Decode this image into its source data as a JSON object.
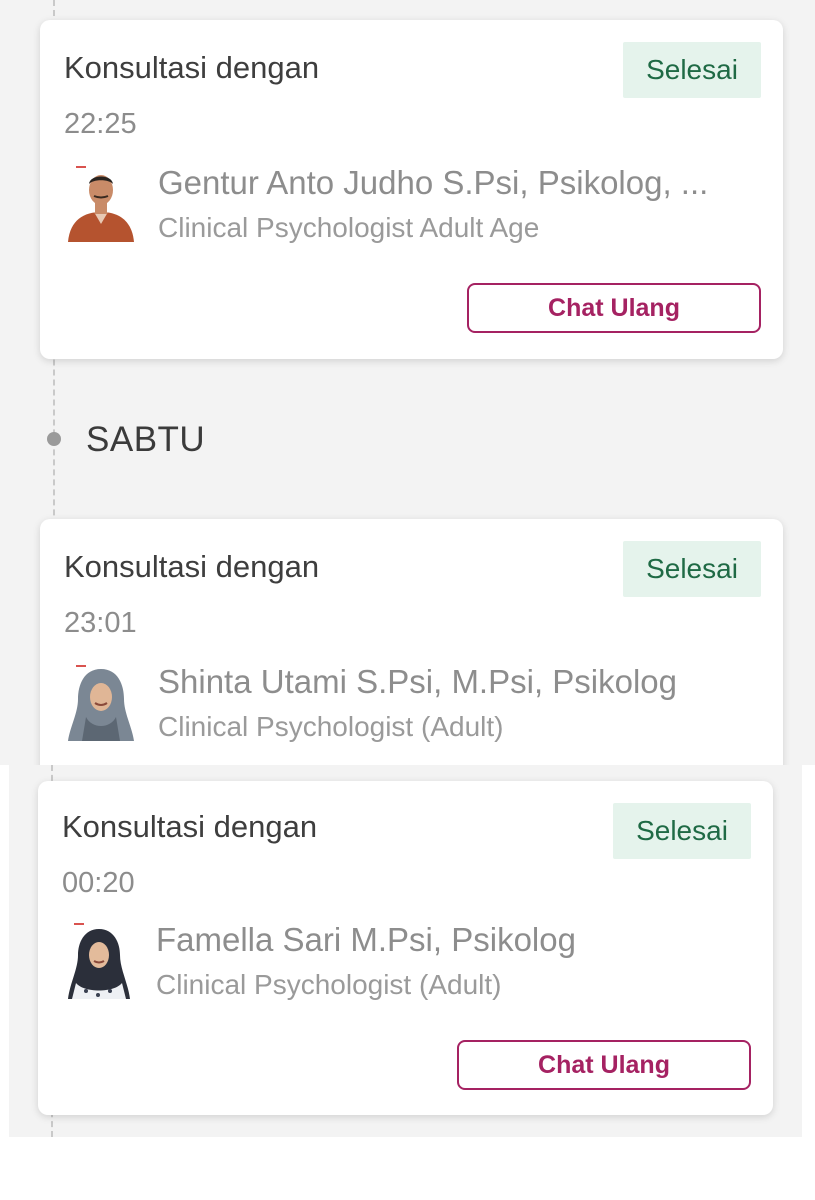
{
  "colors": {
    "background": "#f3f3f3",
    "card": "#ffffff",
    "status_bg": "#e5f3ec",
    "status_text": "#1f6a45",
    "accent": "#a52262",
    "timeline_dot": "#9a9a9a"
  },
  "day_header": {
    "label": "SABTU"
  },
  "consultations": [
    {
      "title": "Konsultasi dengan",
      "status": "Selesai",
      "time": "22:25",
      "doctor_name": "Gentur Anto Judho S.Psi, Psikolog, ...",
      "specialty": "Clinical Psychologist Adult Age",
      "avatar_icon": "doctor-avatar-male",
      "action_label": "Chat Ulang"
    },
    {
      "title": "Konsultasi dengan",
      "status": "Selesai",
      "time": "23:01",
      "doctor_name": "Shinta Utami S.Psi, M.Psi, Psikolog",
      "specialty": "Clinical Psychologist (Adult)",
      "avatar_icon": "doctor-avatar-hijab"
    },
    {
      "title": "Konsultasi dengan",
      "status": "Selesai",
      "time": "00:20",
      "doctor_name": "Famella Sari M.Psi, Psikolog",
      "specialty": "Clinical Psychologist (Adult)",
      "avatar_icon": "doctor-avatar-hijab",
      "action_label": "Chat Ulang"
    }
  ]
}
